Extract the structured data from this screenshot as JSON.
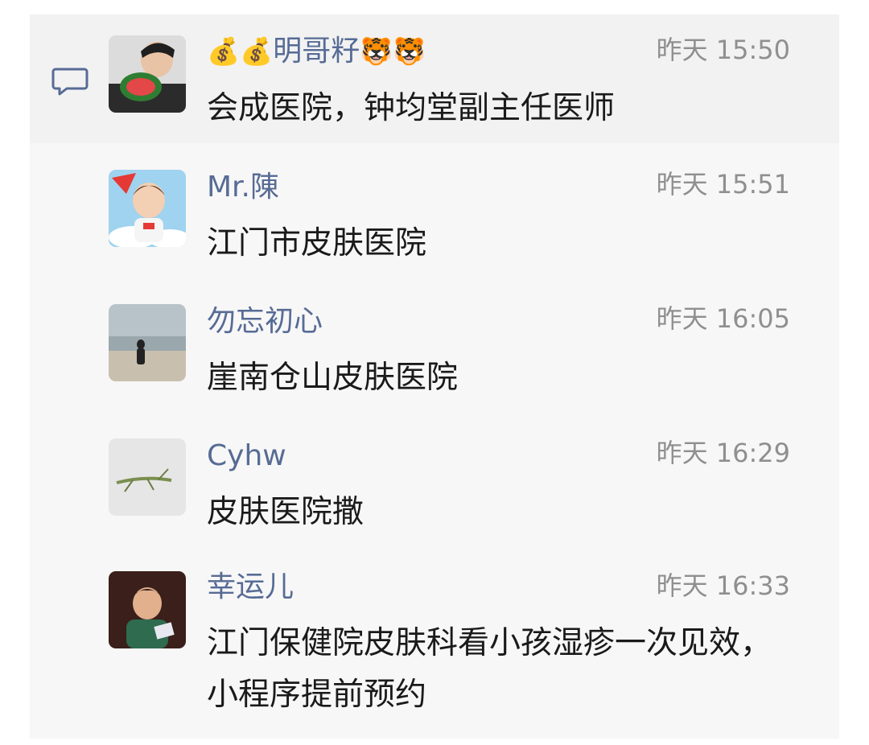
{
  "comments": [
    {
      "name_prefix": "💰💰",
      "name": "明哥籽",
      "name_suffix": "🐯🐯",
      "time": "昨天 15:50",
      "content": "会成医院，钟均堂副主任医师"
    },
    {
      "name": "Mr.陳",
      "time": "昨天 15:51",
      "content": "江门市皮肤医院"
    },
    {
      "name": "勿忘初心",
      "time": "昨天 16:05",
      "content": "崖南仓山皮肤医院"
    },
    {
      "name": "Cyhw",
      "time": "昨天 16:29",
      "content": "皮肤医院撒"
    },
    {
      "name": "幸运儿",
      "time": "昨天 16:33",
      "content": "江门保健院皮肤科看小孩湿疹一次见效，小程序提前预约"
    }
  ],
  "icons": {
    "comment": "comment-bubble-icon"
  },
  "colors": {
    "name": "#576b95",
    "time": "#8f8f8f",
    "content": "#1a1a1a",
    "panel": "#f7f7f7",
    "highlight": "#f2f2f2"
  }
}
